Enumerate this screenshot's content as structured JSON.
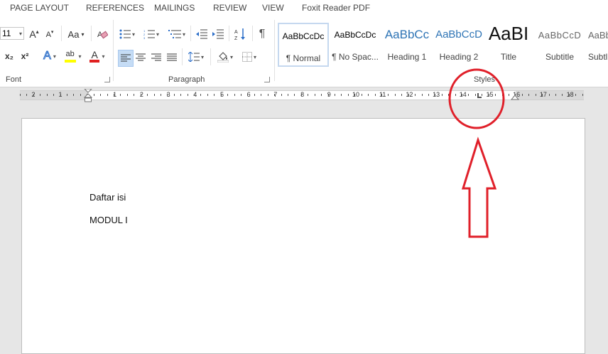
{
  "tabs": [
    "PAGE LAYOUT",
    "REFERENCES",
    "MAILINGS",
    "REVIEW",
    "VIEW",
    "Foxit Reader PDF"
  ],
  "font_group": {
    "size": "11",
    "label": "Font",
    "grow_label": "A",
    "shrink_label": "A",
    "case_label": "Aa",
    "subscript": "x₂",
    "superscript": "x²",
    "text_effects": "A",
    "highlight": "ab",
    "font_color": "A"
  },
  "paragraph_group": {
    "label": "Paragraph"
  },
  "styles_group": {
    "label": "Styles",
    "items": [
      {
        "sample": "AaBbCcDc",
        "name": "¶ Normal"
      },
      {
        "sample": "AaBbCcDc",
        "name": "¶ No Spac..."
      },
      {
        "sample": "AaBbCc",
        "name": "Heading 1"
      },
      {
        "sample": "AaBbCcD",
        "name": "Heading 2"
      },
      {
        "sample": "AaBI",
        "name": "Title"
      },
      {
        "sample": "AaBbCcD",
        "name": "Subtitle"
      },
      {
        "sample": "AaBbCcD",
        "name": "Subtl"
      }
    ]
  },
  "ruler": {
    "left_numbers": [
      "2",
      "1"
    ],
    "right_numbers": [
      "1",
      "2",
      "3",
      "4",
      "5",
      "6",
      "7",
      "8",
      "9",
      "10",
      "11",
      "12",
      "13",
      "14",
      "15",
      "16",
      "17",
      "18"
    ]
  },
  "document": {
    "lines": [
      "Daftar isi",
      "MODUL I"
    ]
  },
  "annotation": {
    "color": "#e0202a"
  }
}
